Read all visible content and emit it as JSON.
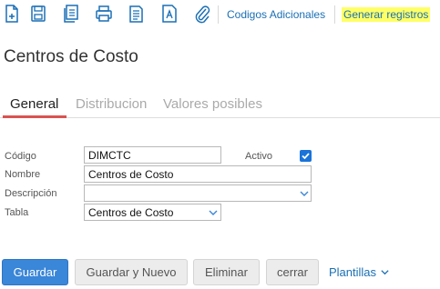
{
  "toolbar": {
    "icons": [
      "new-document-icon",
      "save-icon",
      "copy-icon",
      "print-icon",
      "report-icon",
      "text-document-icon",
      "attachment-icon"
    ],
    "codigos_adicionales": "Codigos Adicionales",
    "generar_registros": "Generar registros",
    "highlight_color": "#ffff66"
  },
  "page": {
    "title": "Centros de Costo"
  },
  "tabs": [
    {
      "label": "General",
      "active": true
    },
    {
      "label": "Distribucion",
      "active": false
    },
    {
      "label": "Valores posibles",
      "active": false
    }
  ],
  "form": {
    "codigo_label": "Código",
    "codigo_value": "DIMCTC",
    "activo_label": "Activo",
    "activo_checked": true,
    "nombre_label": "Nombre",
    "nombre_value": "Centros de Costo",
    "descripcion_label": "Descripción",
    "descripcion_value": "",
    "tabla_label": "Tabla",
    "tabla_value": "Centros de Costo"
  },
  "buttons": {
    "guardar": "Guardar",
    "guardar_y_nuevo": "Guardar y Nuevo",
    "eliminar": "Eliminar",
    "cerrar": "cerrar",
    "plantillas": "Plantillas"
  },
  "colors": {
    "accent": "#1a6fb5",
    "primary_button": "#3a86d8",
    "tab_underline": "#d9534f"
  }
}
